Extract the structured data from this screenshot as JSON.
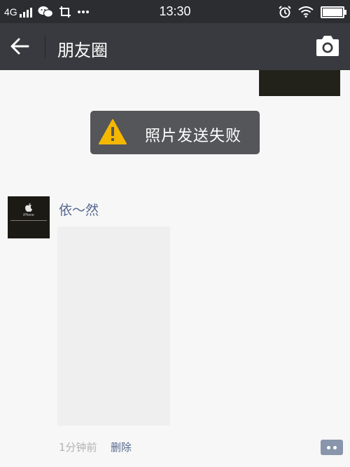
{
  "status_bar": {
    "network": "4G",
    "time": "13:30",
    "icons": [
      "signal-icon",
      "wechat-icon",
      "screenshot-icon",
      "more-dots-icon",
      "alarm-icon",
      "wifi-icon",
      "battery-icon"
    ],
    "battery_level": 1.0
  },
  "header": {
    "title": "朋友圈",
    "back_icon": "arrow-left-icon",
    "camera_icon": "camera-icon"
  },
  "toast": {
    "icon": "warning-icon",
    "text": "照片发送失败",
    "warning_color": "#f5b800"
  },
  "post": {
    "avatar_brand": "iPhone",
    "username": "依～然",
    "time_ago": "1分钟前",
    "delete_label": "删除",
    "comment_icon": "comment-bubble-icon"
  },
  "colors": {
    "title_bar": "#393a3f",
    "status_bar": "#2c2d31",
    "link": "#56698f",
    "background": "#f7f7f7"
  }
}
